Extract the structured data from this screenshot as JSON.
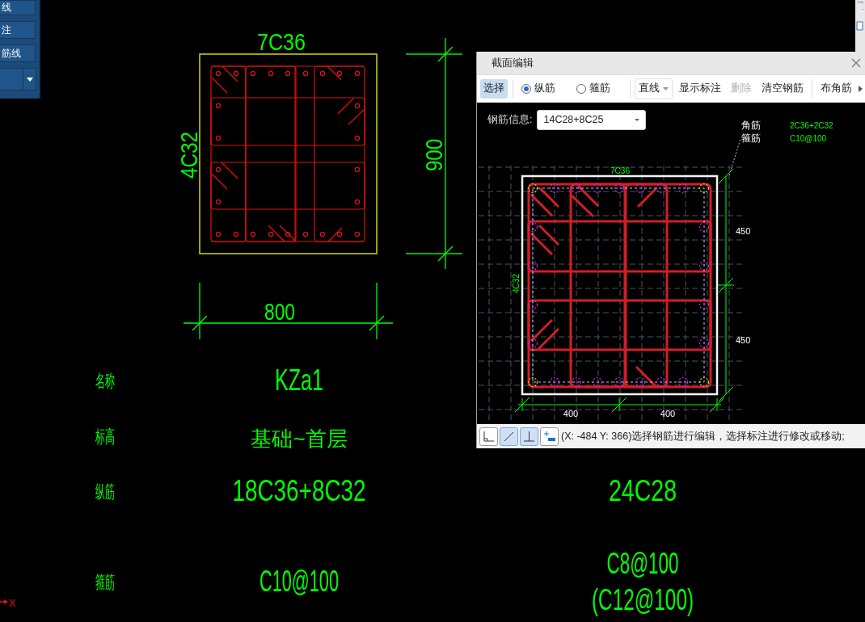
{
  "side_panel": {
    "buttons": [
      {
        "label": "线"
      },
      {
        "label": "注"
      },
      {
        "label": "筋线"
      }
    ]
  },
  "drawing": {
    "top_label": "7C36",
    "side_label": "4C32",
    "height_dim": "900",
    "width_dim": "800"
  },
  "schedule": {
    "rows": [
      {
        "label": "名称",
        "cells": [
          [
            "KZa1"
          ]
        ]
      },
      {
        "label": "标高",
        "cells": [
          [
            "基础~首层"
          ]
        ]
      },
      {
        "label": "纵筋",
        "cells": [
          [
            "18C36+8C32"
          ],
          [
            "24C28"
          ]
        ]
      },
      {
        "label": "箍筋",
        "cells": [
          [
            "C10@100"
          ],
          [
            "C8@100",
            "(C12@100)"
          ]
        ]
      }
    ]
  },
  "ucs": {
    "axis_label": "X"
  },
  "dialog": {
    "title": "截面编辑",
    "toolbar": [
      {
        "kind": "button",
        "label": "选择",
        "selected": true,
        "disabled": false
      },
      {
        "kind": "divider"
      },
      {
        "kind": "radio",
        "label": "纵筋",
        "selected": true
      },
      {
        "kind": "radio",
        "label": "箍筋",
        "selected": false
      },
      {
        "kind": "divider"
      },
      {
        "kind": "dropdown",
        "label": "直线"
      },
      {
        "kind": "button",
        "label": "显示标注",
        "selected": false,
        "disabled": false
      },
      {
        "kind": "button",
        "label": "删除",
        "selected": false,
        "disabled": true
      },
      {
        "kind": "button",
        "label": "清空钢筋",
        "selected": false,
        "disabled": false
      },
      {
        "kind": "divider"
      },
      {
        "kind": "button",
        "label": "布角筋",
        "selected": false,
        "disabled": false
      }
    ],
    "rebar_info": {
      "label": "钢筋信息:",
      "value": "14C28+8C25"
    },
    "legend": [
      {
        "label": "角筋",
        "value": "2C36+2C32"
      },
      {
        "label": "箍筋",
        "value": "C10@100"
      }
    ],
    "section": {
      "top_label": "7C36",
      "side_label": "4C32",
      "right_dims": [
        "450",
        "450"
      ],
      "bottom_dims": [
        "400",
        "400"
      ]
    },
    "status_bar": {
      "tools": [
        {
          "kind": "corner",
          "selected": false
        },
        {
          "kind": "slash",
          "selected": true
        },
        {
          "kind": "perpendicular",
          "selected": true
        },
        {
          "kind": "dimension",
          "selected": false
        }
      ],
      "message": "(X: -484 Y: 366)选择钢筋进行编辑，选择标注进行修改或移动;"
    }
  }
}
